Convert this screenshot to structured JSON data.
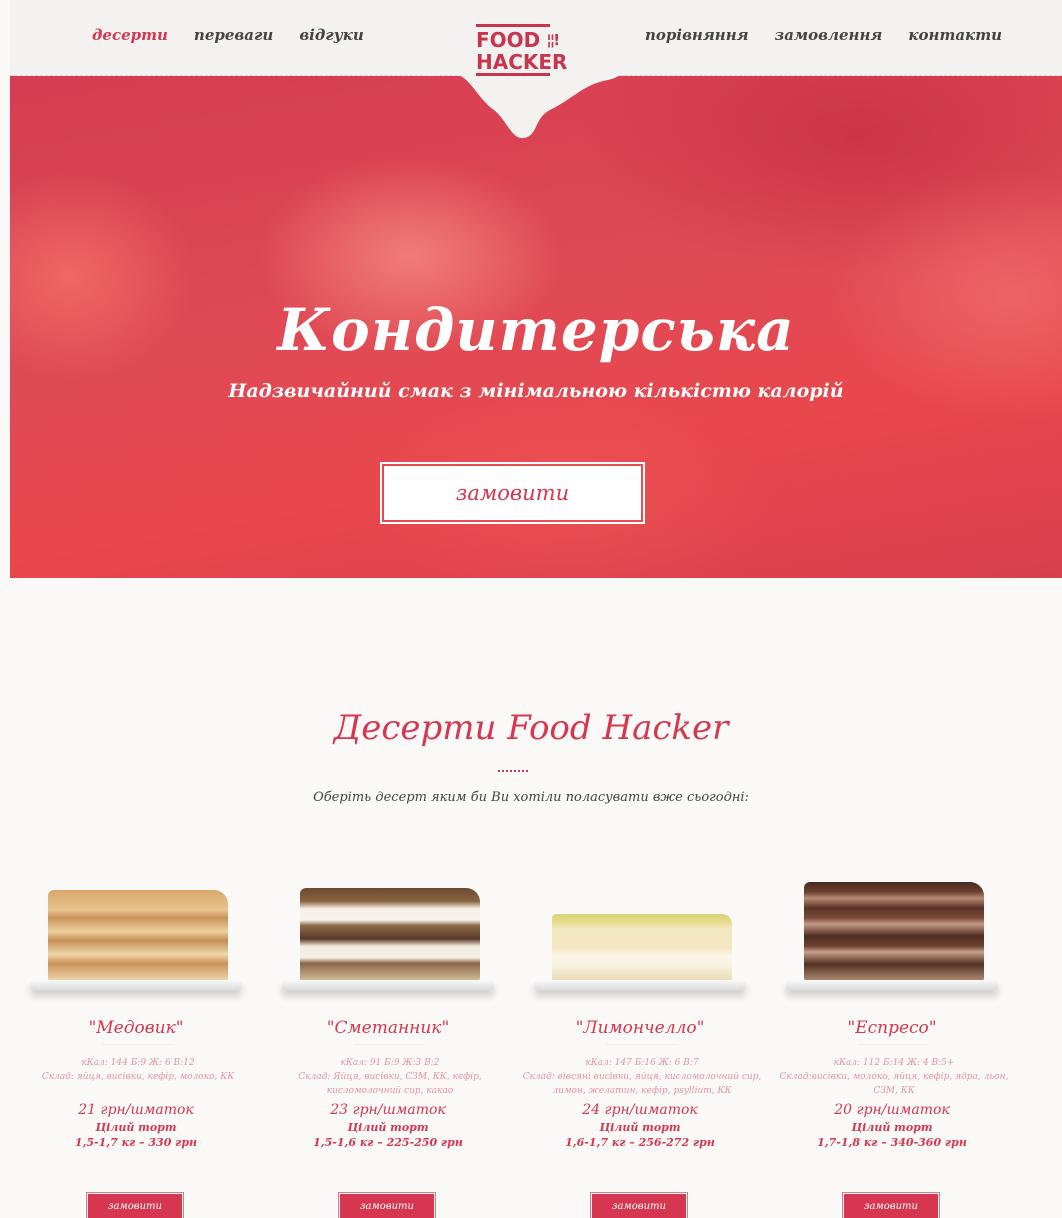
{
  "nav": {
    "left": [
      "десерти",
      "переваги",
      "відгуки"
    ],
    "right": [
      "порівняння",
      "замовлення",
      "контакти"
    ],
    "active": "десерти"
  },
  "logo": {
    "line1": "FOOD",
    "line2": "HACKER",
    "cutlery": "¦¦!"
  },
  "hero": {
    "title": "Кондитерська",
    "subtitle": "Надзвичайний смак з мінімальною кількістю калорій",
    "button": "замовити"
  },
  "section": {
    "title": "Десерти Food Hacker",
    "subtitle": "Оберіть десерт яким би Ви хотіли поласувати вже сьогодні:"
  },
  "products": [
    {
      "name": "\"Медовик\"",
      "kcal": "кКал: 144 Б:9 Ж: 6 В:12",
      "composition": "Склад: яйця, висівки, кефір, молоко, КК",
      "price": "21 грн/шматок",
      "whole": "Цілий торт",
      "whole_price": "1,5-1,7 кг – 330 грн",
      "button": "замовити"
    },
    {
      "name": "\"Сметанник\"",
      "kcal": "кКал: 91 Б:9 Ж:3 В:2",
      "composition": "Склад: Яйця, висівки, СЗМ, КК, кефір, кисломолочний сир, какао",
      "price": "23 грн/шматок",
      "whole": "Цілий торт",
      "whole_price": "1,5-1,6 кг – 225-250 грн",
      "button": "замовити"
    },
    {
      "name": "\"Лимончелло\"",
      "kcal": "кКал: 147 Б:16 Ж: 6 В:7",
      "composition": "Склад: вівсяні висівки, яйця, кисломолочний сир, лимон, желатин, кефір, psyllium, КК",
      "price": "24 грн/шматок",
      "whole": "Цілий торт",
      "whole_price": "1,6-1,7 кг – 256-272 грн",
      "button": "замовити"
    },
    {
      "name": "\"Еспресо\"",
      "kcal": "кКал: 112 Б:14 Ж: 4 В:5+",
      "composition": "Склад:висівки, молоко, яйця, кефір, ядра, льон, СЗМ, КК",
      "price": "20 грн/шматок",
      "whole": "Цілий торт",
      "whole_price": "1,7-1,8 кг – 340-360 грн",
      "button": "замовити"
    }
  ],
  "colors": {
    "accent": "#d6364f",
    "hero": "#e04a55",
    "background": "#fbf9f7"
  }
}
